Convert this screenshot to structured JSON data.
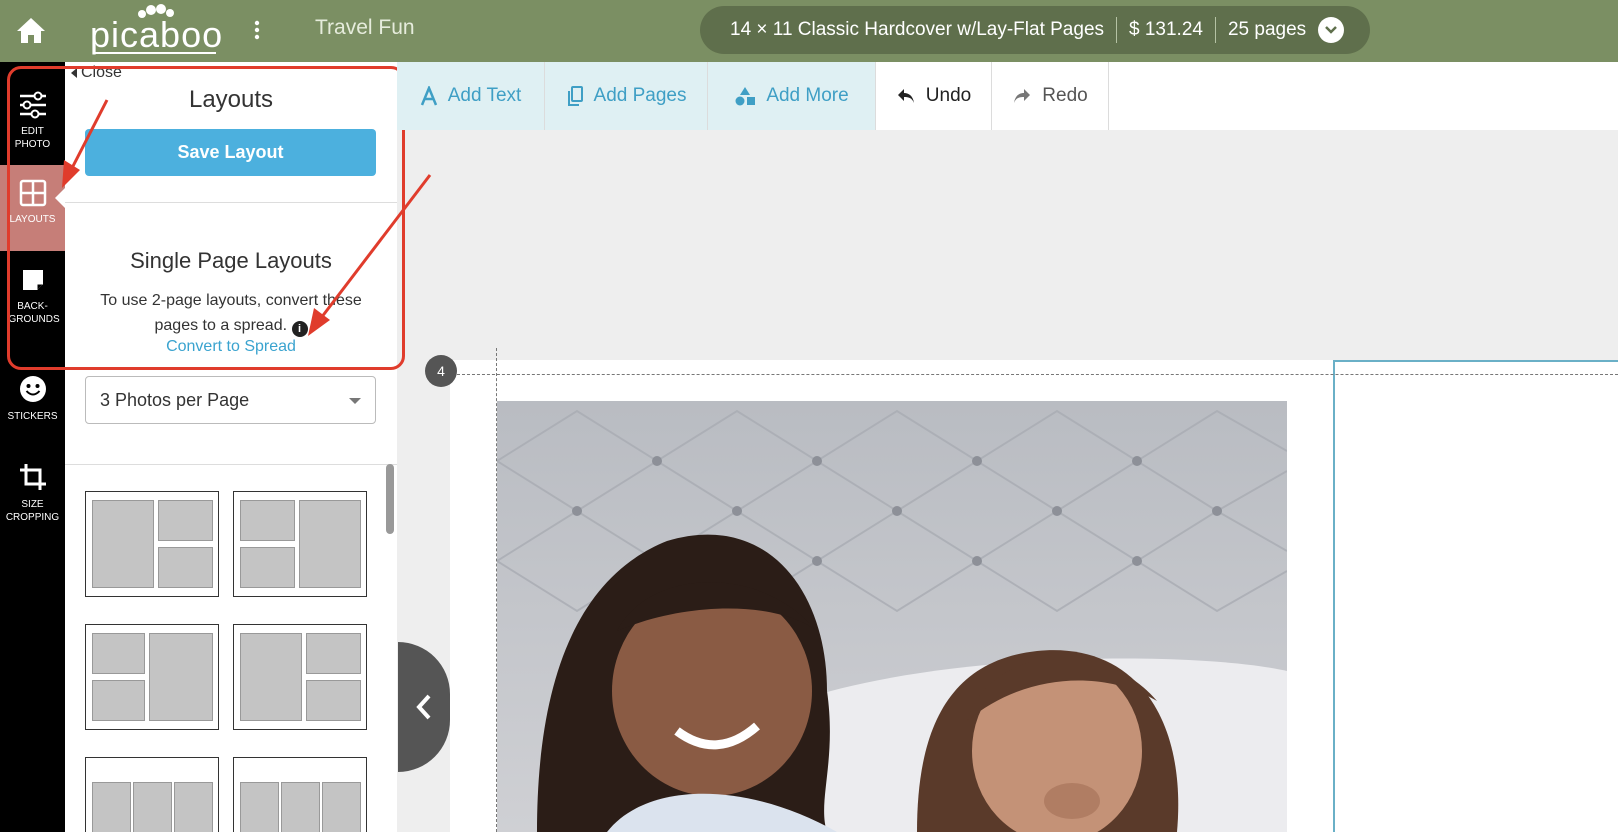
{
  "topbar": {
    "icons": {
      "home": "home-icon",
      "menu": "kebab-menu-icon"
    },
    "logo_text": "picaboo",
    "project_title": "Travel Fun",
    "product": {
      "name": "14 × 11 Classic Hardcover w/Lay-Flat Pages",
      "price": "$ 131.24",
      "pages": "25 pages"
    },
    "colors": {
      "bar": "#7b8f63",
      "pill": "#5f6f4c"
    }
  },
  "rail": {
    "items": [
      {
        "label": "EDIT PHOTO",
        "icon": "sliders-icon"
      },
      {
        "label": "LAYOUTS",
        "icon": "grid-icon",
        "active": true
      },
      {
        "label": "BACK-GROUNDS",
        "icon": "background-icon"
      },
      {
        "label": "STICKERS",
        "icon": "smiley-icon"
      },
      {
        "label": "SIZE CROPPING",
        "icon": "crop-icon"
      }
    ],
    "active_color": "#c67e78"
  },
  "panel": {
    "close_label": "Close",
    "title": "Layouts",
    "save_label": "Save Layout",
    "single_title": "Single Page Layouts",
    "hint": "To use 2-page layouts, convert these pages to a spread.",
    "convert_label": "Convert to Spread",
    "select_value": "3 Photos per Page",
    "accent": "#4cb0de",
    "highlight_color": "#e03c2c"
  },
  "toolbar": {
    "add_text": "Add Text",
    "add_pages": "Add Pages",
    "add_more": "Add More",
    "undo": "Undo",
    "redo": "Redo"
  },
  "canvas": {
    "page_number": "4"
  }
}
